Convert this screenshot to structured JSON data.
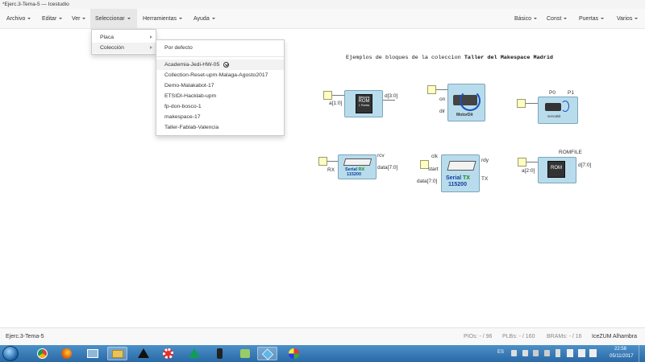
{
  "window": {
    "title": "*Ejerc.3-Tema-5 — Icestudio"
  },
  "menubar": {
    "left": [
      "Archivo",
      "Editar",
      "Ver",
      "Seleccionar",
      "Herramientas",
      "Ayuda"
    ],
    "right": [
      "Básico",
      "Const",
      "Puertas",
      "Varios"
    ]
  },
  "select_menu": {
    "items": [
      "Placa",
      "Colección"
    ]
  },
  "collection_menu": {
    "default_item": "Por defecto",
    "items": [
      "Academia-Jedi-HW-05",
      "Collection-Reset-upm-Malaga-Agosto2017",
      "Demo-Malakabot-17",
      "ETSIDI-Hacklab-upm",
      "fp-don-bosco-1",
      "makespace-17",
      "Taller-Fablab-Valencia"
    ],
    "selected": "Academia-Jedi-HW-05"
  },
  "canvas": {
    "title_prefix": "Ejemplos de bloques de la coleccion ",
    "title_bold": "Taller del Makespace Madrid",
    "blocks": {
      "rom1": {
        "in": "a[1:0]",
        "out": "d[3:0]",
        "chip_top": "Memoria",
        "chip_mid": "ROM",
        "chip_bot": "1 Puerta"
      },
      "motor": {
        "in1": "on",
        "in2": "dir",
        "label": "MotorDit"
      },
      "servo": {
        "top1": "P0",
        "top2": "P1",
        "label": "servoBit"
      },
      "serial_rx": {
        "in": "RX",
        "out1": "rcv",
        "out2": "data[7:0]",
        "name": "Serial",
        "dir": "RX",
        "baud": "115200"
      },
      "serial_tx": {
        "in1": "clk",
        "in2": "start",
        "in3": "data[7:0]",
        "out1": "rdy",
        "out2": "TX",
        "name": "Serial",
        "dir": "TX",
        "baud": "115200"
      },
      "rom2": {
        "top": "ROMFILE",
        "in": "a[2:0]",
        "out": "d[7:0]",
        "chip": "ROM"
      }
    }
  },
  "statusbar": {
    "file": "Ejerc.3-Tema-5",
    "pios": "PIOs: - / 96",
    "plbs": "PLBs: - / 160",
    "brams": "BRAMs: - / 16",
    "board": "IceZUM Alhambra"
  },
  "taskbar": {
    "icons": [
      "start-orb",
      "chrome",
      "firefox",
      "control-panel",
      "file-explorer",
      "inkscape",
      "settings-gear",
      "google-drive",
      "usb-tool",
      "fritzing",
      "icestudio",
      "paint"
    ],
    "language": "ES",
    "time": "22:58",
    "date": "05/11/2017"
  },
  "colors": {
    "block_fill": "#b9dcec",
    "port_fill": "#ffffc4",
    "taskbar": "#2a69a6"
  }
}
